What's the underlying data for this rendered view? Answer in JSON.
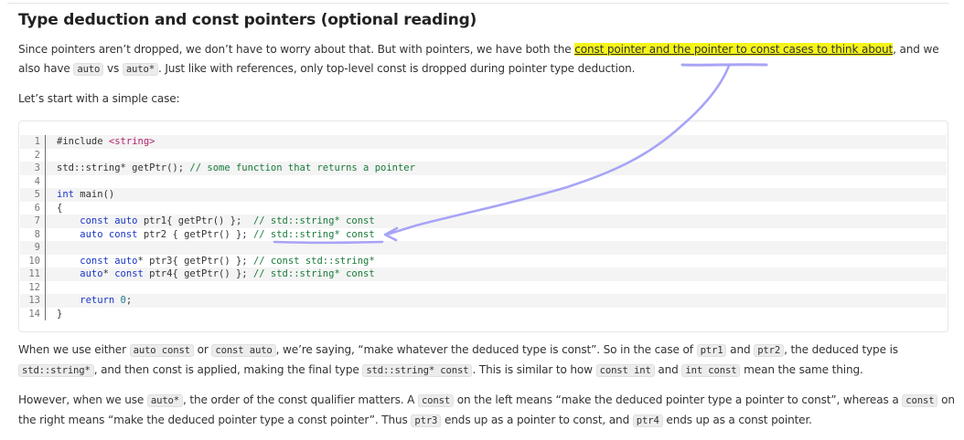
{
  "heading": "Type deduction and const pointers (optional reading)",
  "p1": {
    "line1_pre": "Since pointers aren’t dropped, we don’t have to worry about that. But with pointers, we have both the ",
    "line1_highlight": "const pointer and the pointer to const cases to think about",
    "line1_post": ", and we",
    "line2_a": "also have ",
    "code_auto": "auto",
    "line2_b": " vs ",
    "code_autoptr": "auto*",
    "line2_c": ". Just like with references, only top-level const is dropped during pointer type deduction."
  },
  "p2": "Let’s start with a simple case:",
  "code_lines": [
    {
      "n": "1"
    },
    {
      "n": "2"
    },
    {
      "n": "3"
    },
    {
      "n": "4"
    },
    {
      "n": "5"
    },
    {
      "n": "6"
    },
    {
      "n": "7"
    },
    {
      "n": "8"
    },
    {
      "n": "9"
    },
    {
      "n": "10"
    },
    {
      "n": "11"
    },
    {
      "n": "12"
    },
    {
      "n": "13"
    },
    {
      "n": "14"
    }
  ],
  "code": {
    "l1_a": "#include ",
    "l1_b": "<string>",
    "l3_a": "std::string* getPtr(); ",
    "l3_b": "// some function that returns a pointer",
    "l5_a": "int",
    "l5_b": " main()",
    "l6": "{",
    "l7_a": "    const auto",
    "l7_b": " ptr1{ getPtr() };  ",
    "l7_c": "// std::string* const",
    "l8_a": "    auto const",
    "l8_b": " ptr2 { getPtr() }; ",
    "l8_c": "// std::string* const",
    "l10_a": "    const auto",
    "l10_b": "* ptr3{ getPtr() }; ",
    "l10_c": "// const std::string*",
    "l11_a": "    auto",
    "l11_b": "* ",
    "l11_c": "const",
    "l11_d": " ptr4{ getPtr() }; ",
    "l11_e": "// std::string* const",
    "l13_a": "    return ",
    "l13_b": "0",
    "l13_c": ";",
    "l14": "}"
  },
  "p3": {
    "a": "When we use either ",
    "c1": "auto const",
    "b": " or ",
    "c2": "const auto",
    "c": ", we’re saying, “make whatever the deduced type is const”. So in the case of ",
    "c3": "ptr1",
    "d": " and ",
    "c4": "ptr2",
    "e": ", the deduced type is",
    "c5": "std::string*",
    "f": ", and then const is applied, making the final type ",
    "c6": "std::string* const",
    "g": ". This is similar to how ",
    "c7": "const int",
    "h": " and ",
    "c8": "int const",
    "i": " mean the same thing."
  },
  "p4": {
    "a": "However, when we use ",
    "c1": "auto*",
    "b": ", the order of the const qualifier matters. A ",
    "c2": "const",
    "c": " on the left means “make the deduced pointer type a pointer to const”, whereas a ",
    "c3": "const",
    "d": " on",
    "e": "the right means “make the deduced pointer type a const pointer”. Thus ",
    "c4": "ptr3",
    "f": " ends up as a pointer to const, and ",
    "c5": "ptr4",
    "g": " ends up as a const pointer."
  },
  "colors": {
    "highlight": "#f5f51a",
    "annotation": "#a8a4f5",
    "keyword": "#1a35c5",
    "string": "#b0246e",
    "comment": "#1a7a3a"
  }
}
